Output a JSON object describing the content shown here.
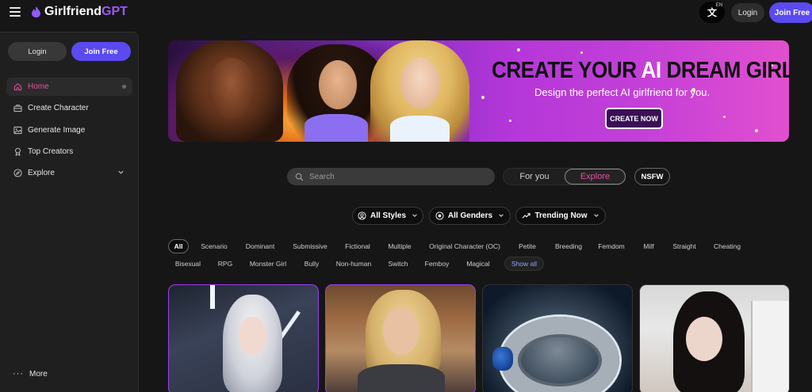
{
  "header": {
    "logo_prefix": "Girlfriend",
    "logo_suffix": "GPT",
    "lang_code": "EN",
    "login_label": "Login",
    "join_label": "Join Free"
  },
  "sidebar": {
    "login_label": "Login",
    "join_label": "Join Free",
    "items": [
      {
        "label": "Home",
        "icon": "home-icon",
        "active": true
      },
      {
        "label": "Create Character",
        "icon": "briefcase-icon"
      },
      {
        "label": "Generate Image",
        "icon": "image-icon"
      },
      {
        "label": "Top Creators",
        "icon": "trophy-icon"
      },
      {
        "label": "Explore",
        "icon": "compass-icon",
        "has_dropdown": true
      }
    ],
    "more_label": "More"
  },
  "banner": {
    "title_part1": "CREATE YOUR ",
    "title_ai": "AI",
    "title_part2": " DREAM GIRL",
    "subtitle": "Design the perfect AI girlfriend for you.",
    "cta_label": "CREATE NOW"
  },
  "search": {
    "placeholder": "Search"
  },
  "segment": {
    "for_you_label": "For you",
    "explore_label": "Explore",
    "selected": "Explore"
  },
  "nsfw_label": "NSFW",
  "filters": {
    "styles_label": "All Styles",
    "genders_label": "All Genders",
    "sort_label": "Trending Now"
  },
  "tags": {
    "row1": [
      "All",
      "Scenario",
      "Dominant",
      "Submissive",
      "Fictional",
      "Multiple",
      "Original Character (OC)",
      "Petite",
      "Breeding",
      "Femdom",
      "Milf",
      "Straight",
      "Cheating"
    ],
    "row2": [
      "Bisexual",
      "RPG",
      "Monster Girl",
      "Bully",
      "Non-human",
      "Switch",
      "Femboy",
      "Magical",
      "Show all"
    ],
    "selected": "All"
  },
  "colors": {
    "accent": "#5b4af0",
    "active_pink": "#e84fa5",
    "logo_purple": "#9a5cf7",
    "card_border_highlight": "#9c3cf0"
  }
}
